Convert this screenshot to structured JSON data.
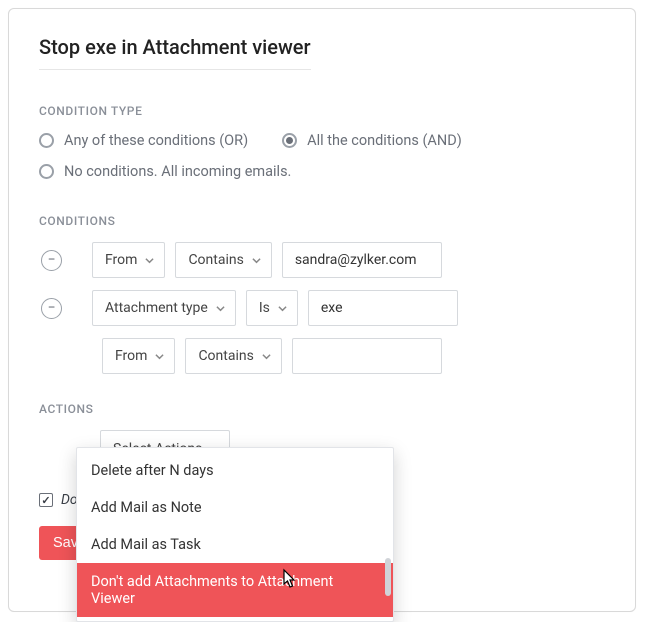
{
  "title": "Stop exe in Attachment viewer",
  "section_condition_type": "CONDITION TYPE",
  "radios": {
    "any": "Any of these conditions (OR)",
    "all": "All the conditions (AND)",
    "none": "No conditions. All incoming emails."
  },
  "selected_radio": "all",
  "section_conditions": "CONDITIONS",
  "conditions": [
    {
      "field": "From",
      "op": "Contains",
      "value": "sandra@zylker.com"
    },
    {
      "field": "Attachment type",
      "op": "Is",
      "value": "exe"
    },
    {
      "field": "From",
      "op": "Contains",
      "value": ""
    }
  ],
  "section_actions": "ACTIONS",
  "select_actions_label": "Select Actions",
  "do_not_apply_label": "Do n",
  "save_label": "Sav",
  "dropdown_items": [
    "Delete after N days",
    "Add Mail as Note",
    "Add Mail as Task",
    "Don't add Attachments to Attachment Viewer"
  ],
  "dropdown_hovered_index": 3
}
